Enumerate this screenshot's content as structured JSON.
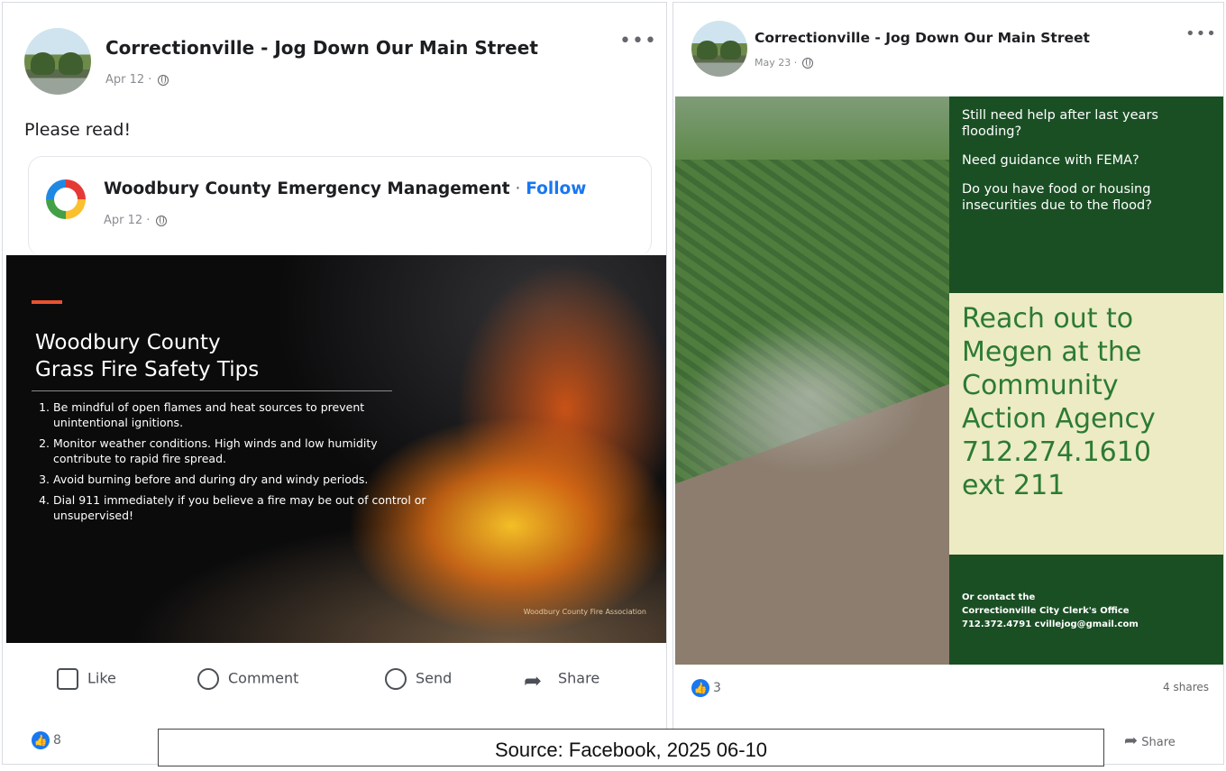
{
  "left_post": {
    "page_name": "Correctionville - Jog Down Our Main Street",
    "date": "Apr 12 ·",
    "more_icon": "ellipsis-icon",
    "text": "Please read!",
    "shared": {
      "page_name": "Woodbury County Emergency Management",
      "separator": " · ",
      "follow": "Follow",
      "date": "Apr 12 ·"
    },
    "image": {
      "title_line1": "Woodbury County",
      "title_line2": "Grass Fire Safety Tips",
      "tips": [
        "Be mindful of open flames and heat sources to prevent unintentional ignitions.",
        "Monitor weather conditions. High winds and low humidity contribute to rapid fire spread.",
        "Avoid burning before and during dry and windy periods.",
        "Dial 911 immediately if you believe a fire may be out of control or unsupervised!"
      ],
      "credit": "Woodbury County Fire Association"
    },
    "actions": {
      "like": "Like",
      "comment": "Comment",
      "send": "Send",
      "share": "Share"
    },
    "reaction_count": "8"
  },
  "right_post": {
    "page_name": "Correctionville - Jog Down Our Main Street",
    "date": "May 23 ·",
    "more_icon": "ellipsis-icon",
    "image": {
      "q1": "Still need help after last years flooding?",
      "q2": "Need guidance with FEMA?",
      "q3": "Do you have food or housing insecurities due to the flood?",
      "reach_lines": [
        "Reach out to",
        "Megen at the",
        "Community",
        "Action Agency",
        "712.274.1610",
        "ext 211"
      ],
      "contact_line1": "Or contact the",
      "contact_line2": "Correctionville City Clerk's Office",
      "contact_line3": "712.372.4791   cvillejog@gmail.com"
    },
    "reaction_count": "3",
    "shares": "4 shares",
    "share": "Share"
  },
  "caption": "Source: Facebook, 2025 06-10",
  "colors": {
    "facebook_blue": "#1877f2",
    "dark_green": "#1a4f24",
    "cream": "#ecebc4",
    "text_green": "#2d7a33"
  }
}
